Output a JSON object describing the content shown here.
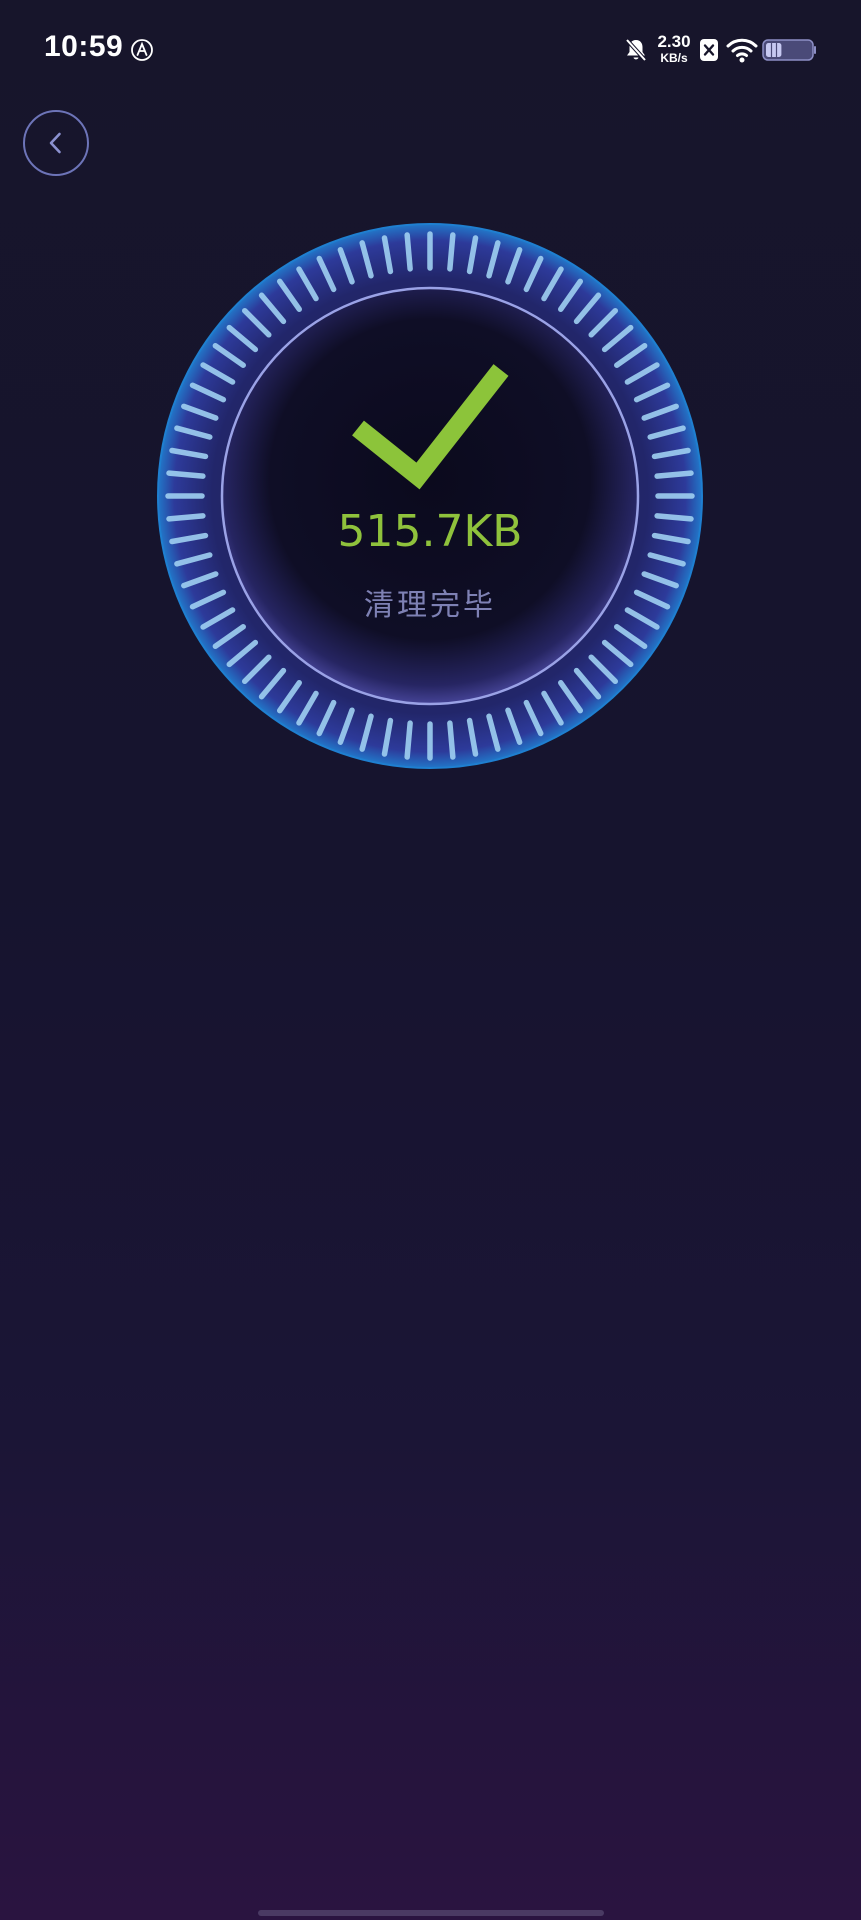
{
  "status_bar": {
    "time": "10:59",
    "speed_value": "2.30",
    "speed_unit": "KB/s",
    "battery_level": 0.35,
    "icons": [
      "auto-icon",
      "bell-off-icon",
      "x-app-icon",
      "wifi-icon",
      "battery-icon"
    ]
  },
  "back_button": {
    "icon": "chevron-left-icon"
  },
  "result": {
    "icon": "check-icon",
    "size": "515.7KB",
    "status": "清理完毕"
  },
  "colors": {
    "background": "#17152b",
    "accent_green": "#8fc23c",
    "tick_blue": "#9fd0f2",
    "status_text": "#7e81b4",
    "ring": "#6f78c8"
  }
}
